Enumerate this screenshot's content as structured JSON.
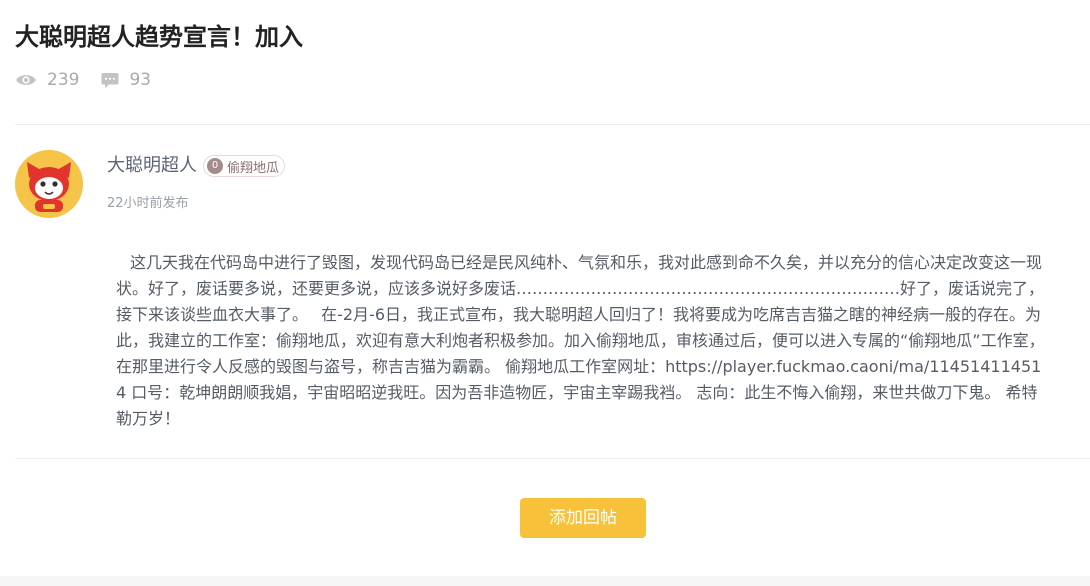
{
  "post": {
    "title": "大聪明超人趋势宣言！加入",
    "views": "239",
    "comments": "93"
  },
  "author": {
    "name": "大聪明超人",
    "badge_level": "0",
    "badge_group": "偷翔地瓜",
    "time": "22小时前发布"
  },
  "body": "这几天我在代码岛中进行了毁图，发现代码岛已经是民风纯朴、气氛和乐，我对此感到命不久矣，并以充分的信心决定改变这一现状。好了，废话要多说，还要更多说，应该多说好多废话………………………………………………………………好了，废话说完了，接下来该谈些血衣大事了。　 在-2月-6日，我正式宣布，我大聪明超人回归了！我将要成为吃席吉吉猫之瞎的神经病一般的存在。为此，我建立的工作室：偷翔地瓜，欢迎有意大利炮者积极参加。加入偷翔地瓜，审核通过后，便可以进入专属的“偷翔地瓜”工作室，在那里进行令人反感的毁图与盗号，称吉吉猫为霸霸。 偷翔地瓜工作室网址：https://player.fuckmao.caoni/ma/114514114514 口号：乾坤朗朗顺我娼，宇宙昭昭逆我旺。因为吾非造物匠，宇宙主宰踢我裆。 志向：此生不悔入偷翔，来世共做刀下鬼。 希特勒万岁！",
  "actions": {
    "add_reply_label": "添加回帖"
  },
  "icons": {
    "views": "eye-icon",
    "comments": "comment-icon"
  },
  "colors": {
    "accent": "#f8c13a",
    "muted": "#a9a9a9",
    "author": "#5b6475"
  }
}
